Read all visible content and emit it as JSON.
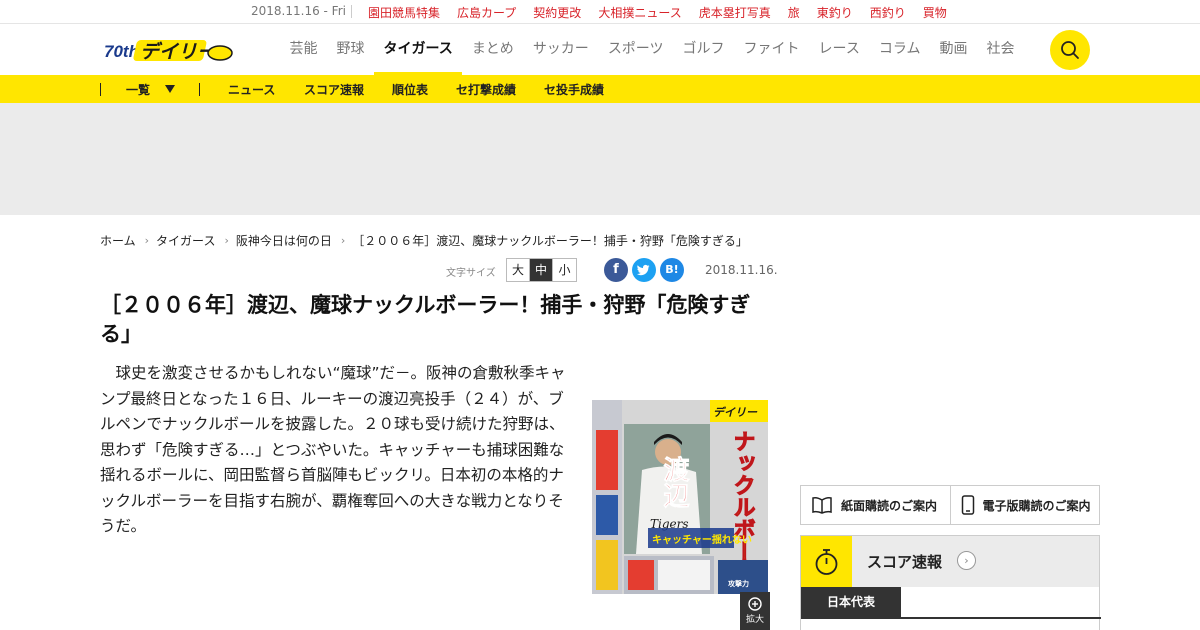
{
  "topbar": {
    "date": "2018.11.16 - Fri",
    "links": [
      "園田競馬特集",
      "広島カープ",
      "契約更改",
      "大相撲ニュース",
      "虎本塁打写真",
      "旅",
      "東釣り",
      "西釣り",
      "買物"
    ]
  },
  "header": {
    "logo_text": "デイリー",
    "logo_badge": "70th",
    "nav": [
      "芸能",
      "野球",
      "タイガース",
      "まとめ",
      "サッカー",
      "スポーツ",
      "ゴルフ",
      "ファイト",
      "レース",
      "コラム",
      "動画",
      "社会"
    ],
    "active_nav": "タイガース",
    "search_icon": "search-icon"
  },
  "subnav": {
    "list_label": "一覧",
    "items": [
      "ニュース",
      "スコア速報",
      "順位表",
      "セ打撃成績",
      "セ投手成績"
    ]
  },
  "breadcrumb": [
    "ホーム",
    "タイガース",
    "阪神今日は何の日",
    "［２００６年］渡辺、魔球ナックルボーラー！捕手・狩野「危険すぎる」"
  ],
  "tools": {
    "font_size_label": "文字サイズ",
    "sizes": [
      "大",
      "中",
      "小"
    ],
    "selected_size": "中",
    "share": [
      {
        "name": "facebook",
        "glyph": "f",
        "color": "#3b5998"
      },
      {
        "name": "twitter",
        "glyph": "t",
        "color": "#1da1f2"
      },
      {
        "name": "hatena",
        "glyph": "B!",
        "color": "#1e88e5"
      }
    ],
    "date": "2018.11.16."
  },
  "article": {
    "headline": "［２００６年］渡辺、魔球ナックルボーラー！捕手・狩野「危険すぎる」",
    "body": "球史を激変させるかもしれない“魔球”だ－。阪神の倉敷秋季キャンプ最終日となった１６日、ルーキーの渡辺亮投手（２４）が、ブルペンでナックルボールを披露した。２０球も受け続けた狩野は、思わず「危険すぎる…」とつぶやいた。キャッチャーも捕球困難な揺れるボールに、岡田監督ら首脳陣もビックリ。日本初の本格的ナックルボーラーを目指す右腕が、覇権奪回への大きな戦力となりそうだ。",
    "photo_texts": {
      "masthead": "デイリー",
      "big_name": "渡辺",
      "headline_vertical": "ナックルボーラー",
      "caption": "キャッチャー揺れない",
      "jersey": "Tigers",
      "corner": "攻撃力"
    },
    "zoom_label": "拡大"
  },
  "sidebar": {
    "paper_sub": "紙面購読のご案内",
    "digital_sub": "電子版購読のご案内",
    "score_title": "スコア速報",
    "score_tab": "日本代表"
  },
  "colors": {
    "brand_yellow": "#ffe600",
    "link_red": "#d8232a"
  }
}
